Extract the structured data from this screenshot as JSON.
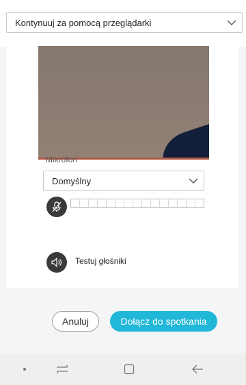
{
  "top": {
    "join_mode_value": "Kontynuuj za pomocą przeglądarki"
  },
  "audio": {
    "microphone_label": "Mikrofon",
    "microphone_device": "Domyślny",
    "level_segments": 15,
    "level_value": 0
  },
  "speaker": {
    "test_label": "Testuj głośniki"
  },
  "actions": {
    "cancel_label": "Anuluj",
    "join_label": "Dołącz do spotkania"
  },
  "icons": {
    "dropdown": "chevron-down-icon",
    "mic_muted": "mic-muted-icon",
    "speaker": "speaker-icon",
    "nav_dot": "dot-icon",
    "nav_recent": "recent-apps-icon",
    "nav_home": "home-icon",
    "nav_back": "back-icon"
  },
  "colors": {
    "join_button": "#20b7d8",
    "icon_circle": "#3a3a3a"
  }
}
